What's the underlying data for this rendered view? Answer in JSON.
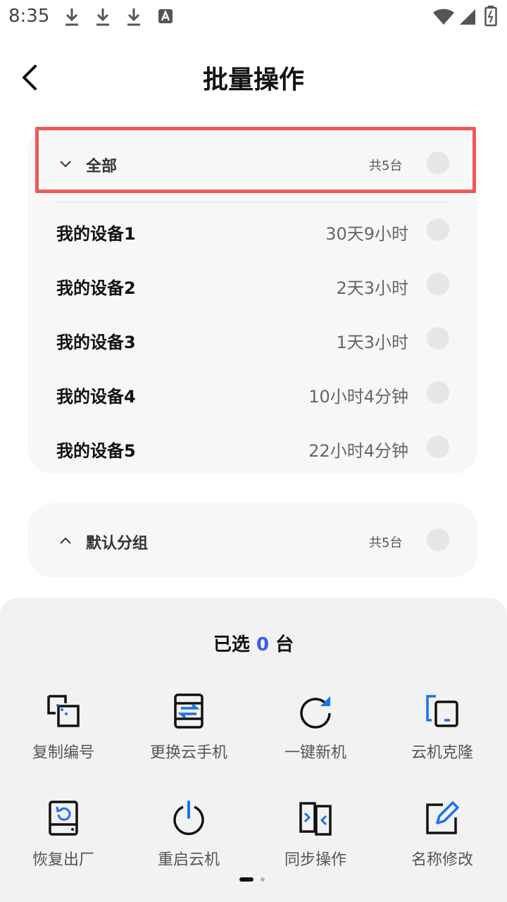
{
  "status_bar": {
    "time": "8:35",
    "left_icons": [
      "download-icon",
      "download-icon",
      "download-icon",
      "text-a-icon"
    ],
    "right_icons": [
      "wifi-icon",
      "signal-icon",
      "battery-icon"
    ]
  },
  "header": {
    "title": "批量操作",
    "back_icon": "chevron-left-icon"
  },
  "groups": [
    {
      "name": "全部",
      "count": "共5台",
      "expanded": true,
      "devices": [
        {
          "name": "我的设备1",
          "time": "30天9小时"
        },
        {
          "name": "我的设备2",
          "time": "2天3小时"
        },
        {
          "name": "我的设备3",
          "time": "1天3小时"
        },
        {
          "name": "我的设备4",
          "time": "10小时4分钟"
        },
        {
          "name": "我的设备5",
          "time": "22小时4分钟"
        }
      ]
    },
    {
      "name": "默认分组",
      "count": "共5台",
      "expanded": false,
      "devices": []
    }
  ],
  "selection": {
    "prefix": "已选",
    "count": "0",
    "suffix": "台"
  },
  "actions": [
    {
      "label": "复制编号",
      "icon": "copy-id-icon"
    },
    {
      "label": "更换云手机",
      "icon": "swap-phone-icon"
    },
    {
      "label": "一键新机",
      "icon": "refresh-icon"
    },
    {
      "label": "云机克隆",
      "icon": "clone-icon"
    },
    {
      "label": "恢复出厂",
      "icon": "factory-reset-icon"
    },
    {
      "label": "重启云机",
      "icon": "power-icon"
    },
    {
      "label": "同步操作",
      "icon": "sync-icon"
    },
    {
      "label": "名称修改",
      "icon": "edit-icon"
    }
  ],
  "pager": {
    "pages": 2,
    "current": 1
  },
  "colors": {
    "accent": "#1a73e8",
    "selected_count": "#3b5cf0",
    "highlight_border": "#ec5a5a",
    "card_bg": "#f7f7f7",
    "sheet_bg": "#f2f2f2"
  }
}
